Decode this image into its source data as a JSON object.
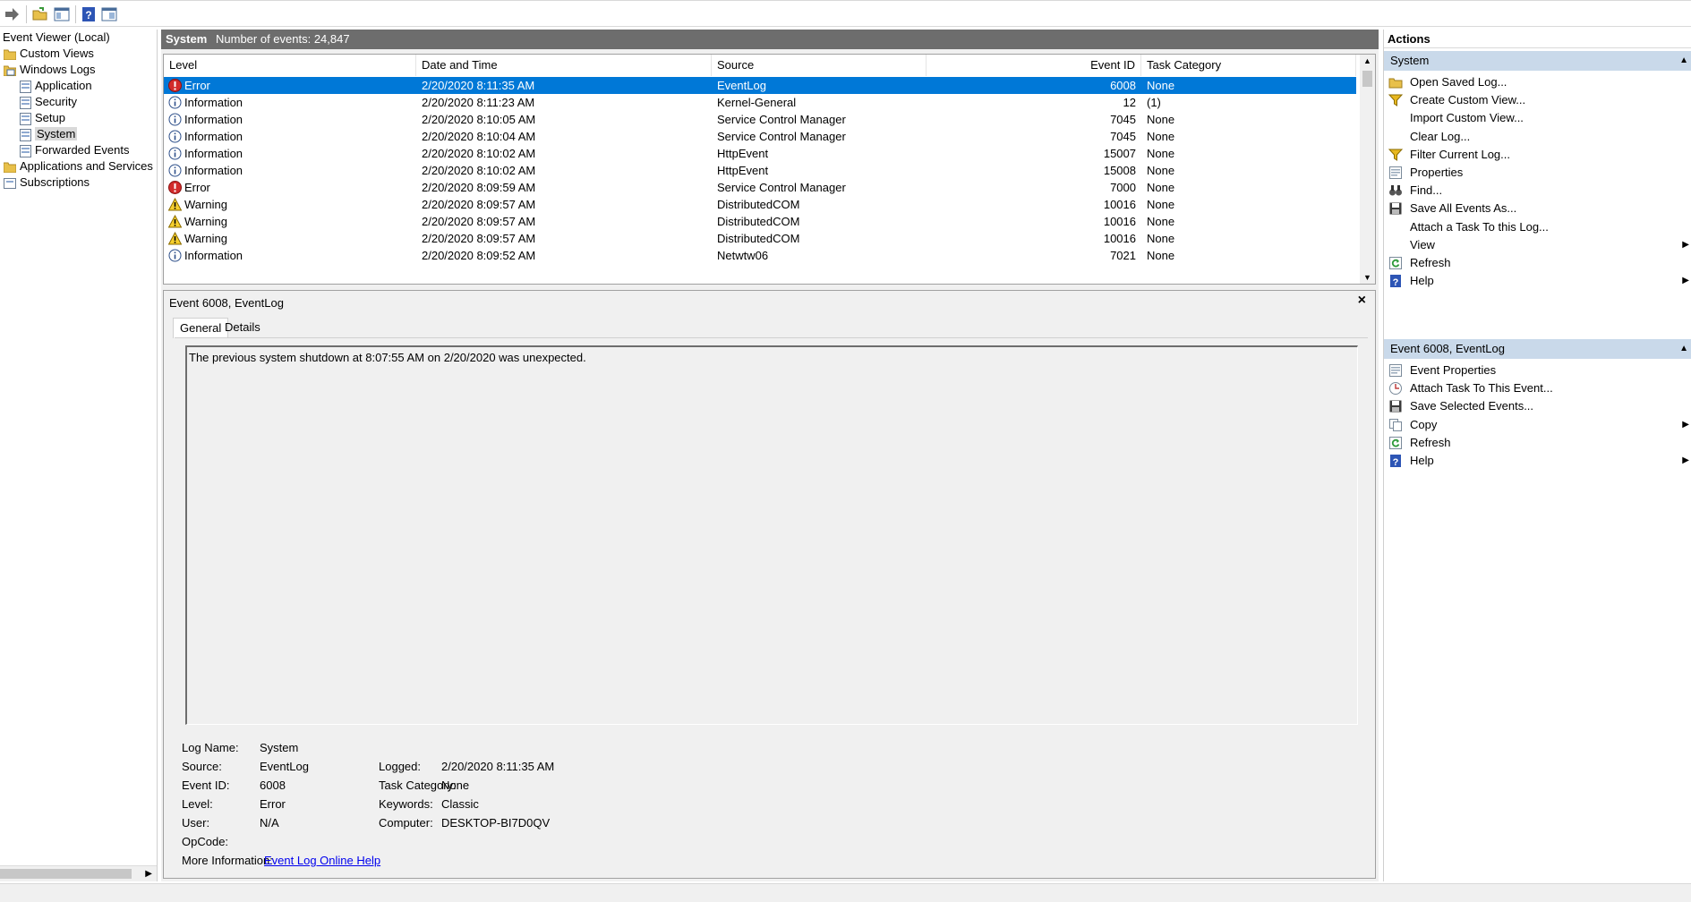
{
  "toolbar": {
    "buttons": [
      "forward-icon",
      "open-folder-icon",
      "show-hide-icon",
      "help-icon",
      "console-tree-icon"
    ]
  },
  "tree": {
    "root": "Event Viewer (Local)",
    "custom_views": "Custom Views",
    "windows_logs": "Windows Logs",
    "application": "Application",
    "security": "Security",
    "setup": "Setup",
    "system": "System",
    "forwarded": "Forwarded Events",
    "apps_services": "Applications and Services Lo",
    "subscriptions": "Subscriptions"
  },
  "log_header": {
    "name": "System",
    "count": "Number of events: 24,847"
  },
  "grid": {
    "columns": [
      "Level",
      "Date and Time",
      "Source",
      "Event ID",
      "Task Category"
    ],
    "rows": [
      {
        "level": "Error",
        "type": "error",
        "date": "2/20/2020 8:11:35 AM",
        "source": "EventLog",
        "id": "6008",
        "cat": "None",
        "selected": true
      },
      {
        "level": "Information",
        "type": "info",
        "date": "2/20/2020 8:11:23 AM",
        "source": "Kernel-General",
        "id": "12",
        "cat": "(1)"
      },
      {
        "level": "Information",
        "type": "info",
        "date": "2/20/2020 8:10:05 AM",
        "source": "Service Control Manager",
        "id": "7045",
        "cat": "None"
      },
      {
        "level": "Information",
        "type": "info",
        "date": "2/20/2020 8:10:04 AM",
        "source": "Service Control Manager",
        "id": "7045",
        "cat": "None"
      },
      {
        "level": "Information",
        "type": "info",
        "date": "2/20/2020 8:10:02 AM",
        "source": "HttpEvent",
        "id": "15007",
        "cat": "None"
      },
      {
        "level": "Information",
        "type": "info",
        "date": "2/20/2020 8:10:02 AM",
        "source": "HttpEvent",
        "id": "15008",
        "cat": "None"
      },
      {
        "level": "Error",
        "type": "error",
        "date": "2/20/2020 8:09:59 AM",
        "source": "Service Control Manager",
        "id": "7000",
        "cat": "None"
      },
      {
        "level": "Warning",
        "type": "warning",
        "date": "2/20/2020 8:09:57 AM",
        "source": "DistributedCOM",
        "id": "10016",
        "cat": "None"
      },
      {
        "level": "Warning",
        "type": "warning",
        "date": "2/20/2020 8:09:57 AM",
        "source": "DistributedCOM",
        "id": "10016",
        "cat": "None"
      },
      {
        "level": "Warning",
        "type": "warning",
        "date": "2/20/2020 8:09:57 AM",
        "source": "DistributedCOM",
        "id": "10016",
        "cat": "None"
      },
      {
        "level": "Information",
        "type": "info",
        "date": "2/20/2020 8:09:52 AM",
        "source": "Netwtw06",
        "id": "7021",
        "cat": "None"
      }
    ]
  },
  "detail": {
    "title": "Event 6008, EventLog",
    "close": "×",
    "tabs": [
      "General",
      "Details"
    ],
    "description": "The previous system shutdown at 8:07:55 AM on 2/20/2020 was unexpected.",
    "labels": {
      "log_name": "Log Name:",
      "source": "Source:",
      "event_id": "Event ID:",
      "level": "Level:",
      "user": "User:",
      "opcode": "OpCode:",
      "more_info": "More Information:",
      "logged": "Logged:",
      "task_category": "Task Category:",
      "keywords": "Keywords:",
      "computer": "Computer:"
    },
    "values": {
      "log_name": "System",
      "source": "EventLog",
      "event_id": "6008",
      "level": "Error",
      "user": "N/A",
      "opcode": "",
      "more_info": "Event Log Online Help",
      "logged": "2/20/2020 8:11:35 AM",
      "task_category": "None",
      "keywords": "Classic",
      "computer": "DESKTOP-BI7D0QV"
    }
  },
  "actions": {
    "title": "Actions",
    "system_section": "System",
    "system_items": [
      {
        "label": "Open Saved Log...",
        "icon": "open-folder-icon"
      },
      {
        "label": "Create Custom View...",
        "icon": "filter-icon"
      },
      {
        "label": "Import Custom View...",
        "icon": ""
      },
      {
        "label": "Clear Log...",
        "icon": ""
      },
      {
        "label": "Filter Current Log...",
        "icon": "filter-icon"
      },
      {
        "label": "Properties",
        "icon": "properties-icon"
      },
      {
        "label": "Find...",
        "icon": "binoculars-icon"
      },
      {
        "label": "Save All Events As...",
        "icon": "save-icon"
      },
      {
        "label": "Attach a Task To this Log...",
        "icon": ""
      },
      {
        "label": "View",
        "icon": "",
        "submenu": true
      },
      {
        "label": "Refresh",
        "icon": "refresh-icon"
      },
      {
        "label": "Help",
        "icon": "help-icon",
        "submenu": true
      }
    ],
    "event_section": "Event 6008, EventLog",
    "event_items": [
      {
        "label": "Event Properties",
        "icon": "properties-icon"
      },
      {
        "label": "Attach Task To This Event...",
        "icon": "task-icon"
      },
      {
        "label": "Save Selected Events...",
        "icon": "save-icon"
      },
      {
        "label": "Copy",
        "icon": "copy-icon",
        "submenu": true
      },
      {
        "label": "Refresh",
        "icon": "refresh-icon"
      },
      {
        "label": "Help",
        "icon": "help-icon",
        "submenu": true
      }
    ]
  },
  "colors": {
    "selection": "#0078d7",
    "section_header": "#c9d9ea",
    "log_header": "#6d6d6d"
  }
}
